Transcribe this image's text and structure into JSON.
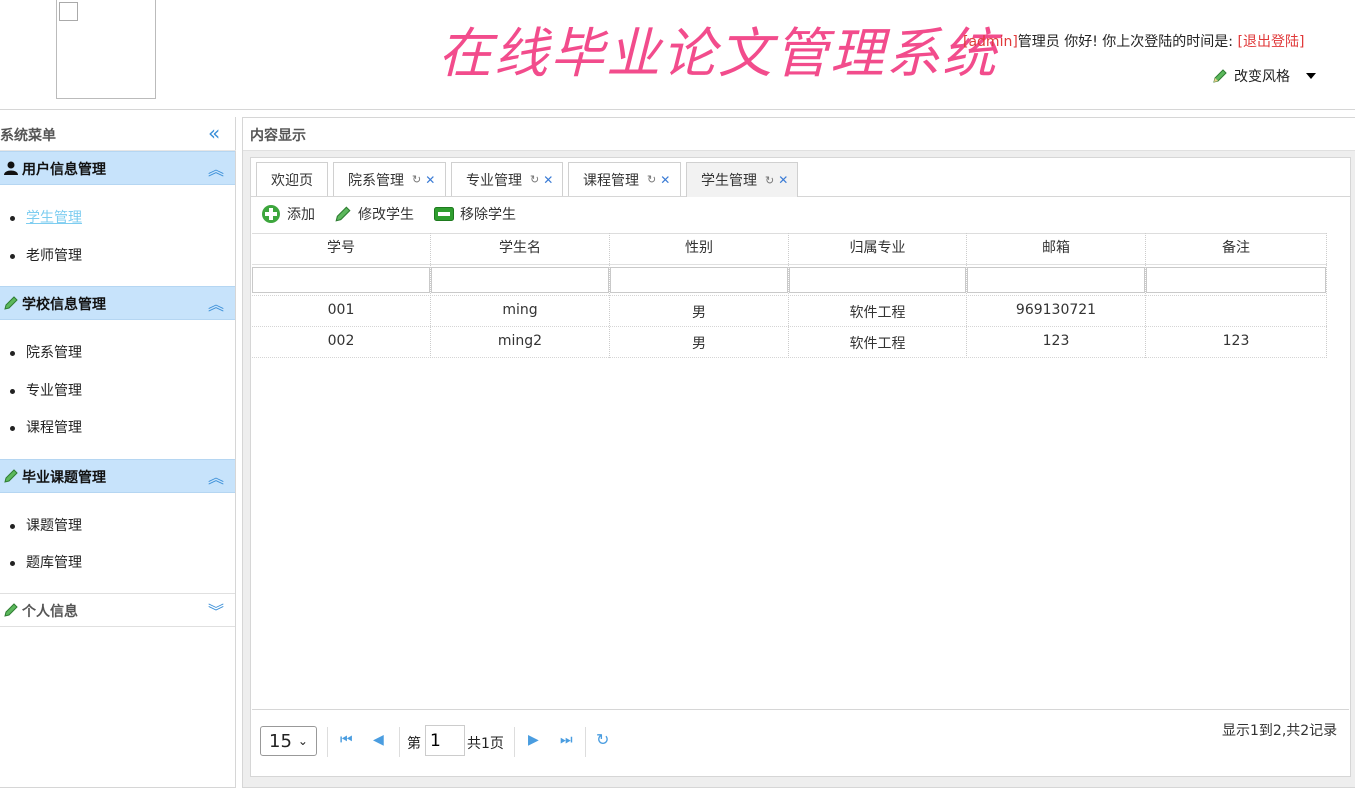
{
  "header": {
    "title": "在线毕业论文管理系统",
    "user_name": "[admin]",
    "user_greeting": "管理员 你好! 你上次登陆的时间是:",
    "logout": "[退出登陆]",
    "theme_switch": "改变风格"
  },
  "sidebar": {
    "title": "系统菜单",
    "groups": [
      {
        "label": "用户信息管理",
        "items": [
          "学生管理",
          "老师管理"
        ]
      },
      {
        "label": "学校信息管理",
        "items": [
          "院系管理",
          "专业管理",
          "课程管理"
        ]
      },
      {
        "label": "毕业课题管理",
        "items": [
          "课题管理",
          "题库管理"
        ]
      },
      {
        "label": "个人信息",
        "items": []
      }
    ],
    "active_item": "学生管理"
  },
  "content": {
    "title": "内容显示",
    "tabs": [
      {
        "label": "欢迎页"
      },
      {
        "label": "院系管理"
      },
      {
        "label": "专业管理"
      },
      {
        "label": "课程管理"
      },
      {
        "label": "学生管理"
      }
    ],
    "active_tab": "学生管理",
    "toolbar": {
      "add": "添加",
      "edit": "修改学生",
      "remove": "移除学生"
    },
    "table": {
      "columns": [
        "学号",
        "学生名",
        "性别",
        "归属专业",
        "邮箱",
        "备注"
      ],
      "rows": [
        [
          "001",
          "ming",
          "男",
          "软件工程",
          "969130721",
          ""
        ],
        [
          "002",
          "ming2",
          "男",
          "软件工程",
          "123",
          "123"
        ]
      ]
    },
    "pager": {
      "page_size": "15",
      "page_prefix": "第",
      "page_value": "1",
      "page_total": "共1页",
      "info": "显示1到2,共2记录"
    }
  },
  "colors": {
    "title_pink": "#f24c8c",
    "group_header_bg": "#c7e3fb",
    "accent_blue": "#3a8fd8",
    "link_red": "#e0393a"
  }
}
